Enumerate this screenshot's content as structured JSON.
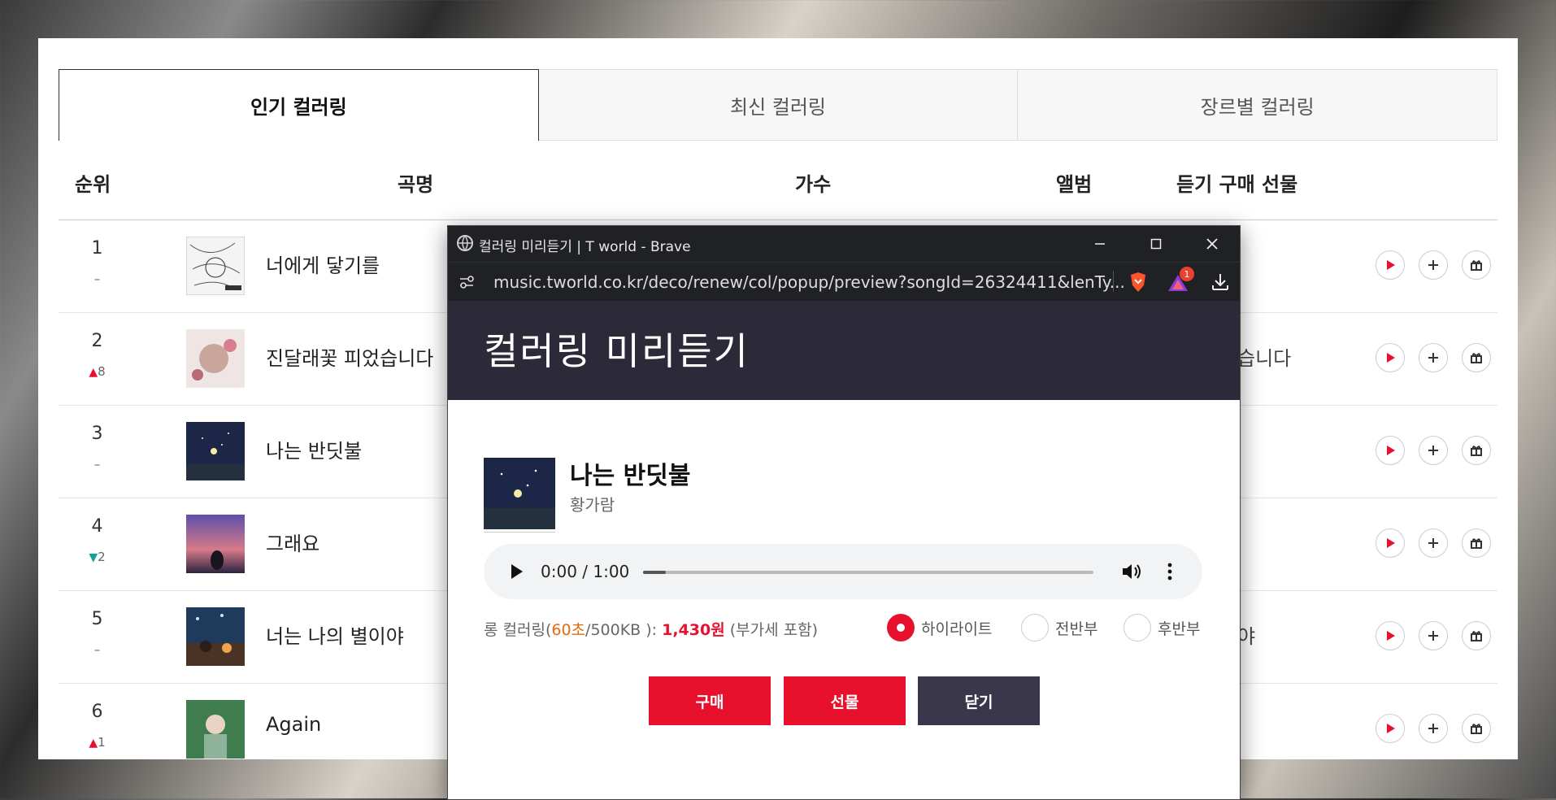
{
  "tabs": [
    "인기 컬러링",
    "최신 컬러링",
    "장르별 컬러링"
  ],
  "columns": {
    "rank": "순위",
    "song": "곡명",
    "artist": "가수",
    "album": "앨범",
    "actions": "듣기 구매 선물"
  },
  "rows": [
    {
      "rank": "1",
      "change": "–",
      "title": "너에게 닿기를",
      "album_tail": ""
    },
    {
      "rank": "2",
      "change": "8",
      "dir": "up",
      "title": "진달래꽃 피었습니다",
      "album_tail": "습니다"
    },
    {
      "rank": "3",
      "change": "–",
      "title": "나는 반딧불",
      "album_tail": ""
    },
    {
      "rank": "4",
      "change": "2",
      "dir": "down",
      "title": "그래요",
      "album_tail": ""
    },
    {
      "rank": "5",
      "change": "–",
      "title": "너는 나의 별이야",
      "album_tail": "야"
    },
    {
      "rank": "6",
      "change": "1",
      "dir": "up",
      "title": "Again",
      "album_tail": ""
    }
  ],
  "popup": {
    "window_title": "컬러링 미리듣기 | T world - Brave",
    "url": "music.tworld.co.kr/deco/renew/col/popup/preview?songId=26324411&lenTy...",
    "notification_count": "1",
    "heading": "컬러링 미리듣기",
    "song_title": "나는 반딧불",
    "artist": "황가람",
    "time": "0:00 / 1:00",
    "progress": 0.05,
    "info_prefix": "롱 컬러링(",
    "info_seconds": "60초",
    "info_size": "/500KB ):",
    "price": "1,430원",
    "vat": "(부가세 포함)",
    "options": [
      "하이라이트",
      "전반부",
      "후반부"
    ],
    "selected_option": "하이라이트",
    "buttons": {
      "buy": "구매",
      "gift": "선물",
      "close": "닫기"
    }
  },
  "colors": {
    "accent": "#e8112d",
    "header_bg": "#2c2a38",
    "dark_button": "#3a374d",
    "browser_chrome": "#202124"
  }
}
